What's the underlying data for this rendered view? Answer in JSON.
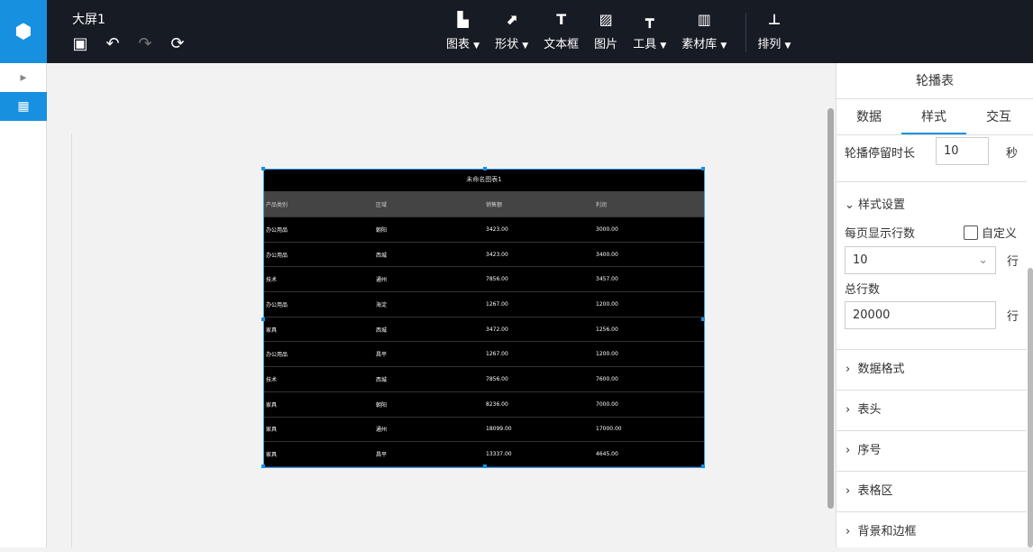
{
  "header": {
    "title": "大屏1",
    "tools": [
      {
        "label": "图表",
        "icon": "bar-chart-icon",
        "dropdown": true
      },
      {
        "label": "形状",
        "icon": "shape-icon",
        "dropdown": true
      },
      {
        "label": "文本框",
        "icon": "textbox-icon",
        "dropdown": false
      },
      {
        "label": "图片",
        "icon": "image-icon",
        "dropdown": false
      },
      {
        "label": "工具",
        "icon": "hammer-icon",
        "dropdown": true
      },
      {
        "label": "素材库",
        "icon": "library-icon",
        "dropdown": true
      },
      {
        "label": "排列",
        "icon": "align-icon",
        "dropdown": true
      }
    ]
  },
  "table": {
    "title": "未命名图表1",
    "headers": [
      "产品类别",
      "区域",
      "销售额",
      "利润"
    ],
    "rows": [
      [
        "办公用品",
        "朝阳",
        "3423.00",
        "3000.00"
      ],
      [
        "办公用品",
        "西城",
        "3423.00",
        "3400.00"
      ],
      [
        "技术",
        "通州",
        "7856.00",
        "3457.00"
      ],
      [
        "办公用品",
        "海淀",
        "1267.00",
        "1200.00"
      ],
      [
        "家具",
        "西城",
        "3472.00",
        "1256.00"
      ],
      [
        "办公用品",
        "昌平",
        "1267.00",
        "1200.00"
      ],
      [
        "技术",
        "西城",
        "7856.00",
        "7600.00"
      ],
      [
        "家具",
        "朝阳",
        "8236.00",
        "7000.00"
      ],
      [
        "家具",
        "通州",
        "18099.00",
        "17000.00"
      ],
      [
        "家具",
        "昌平",
        "13337.00",
        "4645.00"
      ]
    ]
  },
  "panel": {
    "title": "轮播表",
    "tabs": [
      "数据",
      "样式",
      "交互"
    ],
    "active_tab": "样式",
    "dwell_label": "轮播停留时长",
    "dwell_value": "10",
    "dwell_unit": "秒",
    "style_section": "样式设置",
    "rows_per_page_label": "每页显示行数",
    "custom_label": "自定义",
    "rows_per_page": "10",
    "row_unit": "行",
    "total_rows_label": "总行数",
    "total_rows": "20000",
    "sections": [
      "数据格式",
      "表头",
      "序号",
      "表格区",
      "背景和边框"
    ]
  }
}
